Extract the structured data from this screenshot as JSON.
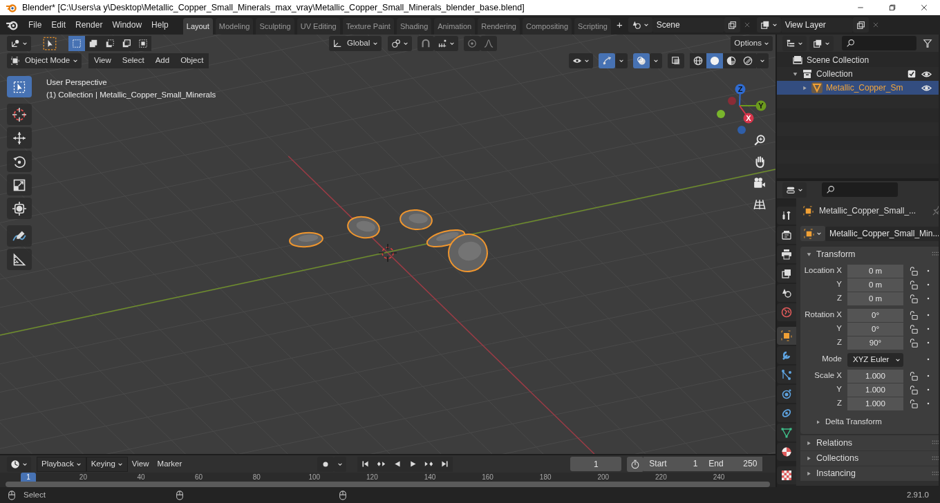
{
  "window": {
    "title": "Blender* [C:\\Users\\a y\\Desktop\\Metallic_Copper_Small_Minerals_max_vray\\Metallic_Copper_Small_Minerals_blender_base.blend]"
  },
  "menu": [
    "File",
    "Edit",
    "Render",
    "Window",
    "Help"
  ],
  "workspaces": [
    {
      "label": "Layout",
      "selected": true
    },
    {
      "label": "Modeling",
      "selected": false
    },
    {
      "label": "Sculpting",
      "selected": false
    },
    {
      "label": "UV Editing",
      "selected": false
    },
    {
      "label": "Texture Paint",
      "selected": false
    },
    {
      "label": "Shading",
      "selected": false
    },
    {
      "label": "Animation",
      "selected": false
    },
    {
      "label": "Rendering",
      "selected": false
    },
    {
      "label": "Compositing",
      "selected": false
    },
    {
      "label": "Scripting",
      "selected": false
    }
  ],
  "add_workspace": "+",
  "scene": "Scene",
  "view_layer": "View Layer",
  "tool_header": {
    "select_modes": [
      {
        "kind": "set",
        "selected": true
      },
      {
        "kind": "extend",
        "selected": false
      },
      {
        "kind": "subtract",
        "selected": false
      },
      {
        "kind": "invert",
        "selected": false
      },
      {
        "kind": "intersect",
        "selected": false
      }
    ],
    "orientation": "Global",
    "options": "Options"
  },
  "viewport_header": {
    "mode": "Object Mode",
    "menus": [
      "View",
      "Select",
      "Add",
      "Object"
    ],
    "gizmos_on": true,
    "overlays_on": true,
    "xray_on": false,
    "shading": [
      {
        "kind": "wireframe",
        "selected": false
      },
      {
        "kind": "solid",
        "selected": true
      },
      {
        "kind": "material",
        "selected": false
      },
      {
        "kind": "rendered",
        "selected": false
      }
    ]
  },
  "viewport": {
    "perspective": "User Perspective",
    "context": "(1) Collection | Metallic_Copper_Small_Minerals",
    "tools": [
      {
        "kind": "select",
        "selected": true
      },
      {
        "kind": "cursor",
        "selected": false
      },
      {
        "kind": "move",
        "selected": false
      },
      {
        "kind": "rotate",
        "selected": false
      },
      {
        "kind": "scale",
        "selected": false
      },
      {
        "kind": "transform",
        "selected": false
      },
      {
        "kind": "annotate",
        "selected": false
      },
      {
        "kind": "measure",
        "selected": false
      }
    ],
    "gizmo": {
      "z": "Z",
      "y": "Y",
      "x": "X"
    }
  },
  "outliner": {
    "items": [
      {
        "label": "Scene Collection",
        "kind": "scene",
        "selected": false,
        "children": [
          {
            "label": "Collection",
            "kind": "collection",
            "expanded": true,
            "checked": true,
            "selected": false,
            "children": [
              {
                "label": "Metallic_Copper_Sm",
                "kind": "mesh",
                "expanded": false,
                "selected": true
              }
            ]
          }
        ]
      }
    ]
  },
  "properties": {
    "tabs": [
      {
        "kind": "tool",
        "selected": false
      },
      {
        "kind": "render",
        "selected": false
      },
      {
        "kind": "output",
        "selected": false
      },
      {
        "kind": "view_layer",
        "selected": false
      },
      {
        "kind": "scene",
        "selected": false
      },
      {
        "kind": "world",
        "selected": false
      },
      {
        "kind": "object",
        "selected": true
      },
      {
        "kind": "modifiers",
        "selected": false
      },
      {
        "kind": "particles",
        "selected": false
      },
      {
        "kind": "physics",
        "selected": false
      },
      {
        "kind": "constraints",
        "selected": false
      },
      {
        "kind": "data",
        "selected": false
      },
      {
        "kind": "material",
        "selected": false
      },
      {
        "kind": "texture",
        "selected": false
      }
    ],
    "object_name": "Metallic_Copper_Small_...",
    "data_name": "Metallic_Copper_Small_Min...",
    "transform": {
      "title": "Transform",
      "expanded": true,
      "groups": [
        {
          "rows": [
            {
              "kind": "number",
              "label": "Location X",
              "value": "0 m"
            },
            {
              "kind": "number",
              "label": "Y",
              "value": "0 m"
            },
            {
              "kind": "number",
              "label": "Z",
              "value": "0 m"
            }
          ]
        },
        {
          "rows": [
            {
              "kind": "number",
              "label": "Rotation X",
              "value": "0°"
            },
            {
              "kind": "number",
              "label": "Y",
              "value": "0°"
            },
            {
              "kind": "number",
              "label": "Z",
              "value": "90°"
            }
          ]
        },
        {
          "rows": [
            {
              "kind": "dropdown",
              "label": "Mode",
              "value": "XYZ Euler"
            }
          ]
        },
        {
          "rows": [
            {
              "kind": "number",
              "label": "Scale X",
              "value": "1.000"
            },
            {
              "kind": "number",
              "label": "Y",
              "value": "1.000"
            },
            {
              "kind": "number",
              "label": "Z",
              "value": "1.000"
            }
          ]
        }
      ],
      "subpanel": {
        "title": "Delta Transform",
        "expanded": false
      }
    },
    "panels": [
      {
        "title": "Relations",
        "expanded": false
      },
      {
        "title": "Collections",
        "expanded": false
      },
      {
        "title": "Instancing",
        "expanded": false
      }
    ]
  },
  "timeline": {
    "menus": [
      "Playback",
      "Keying",
      "View",
      "Marker"
    ],
    "current_frame": "1",
    "start_label": "Start",
    "start": "1",
    "end_label": "End",
    "end": "250",
    "ruler_current": "1",
    "ruler": [
      "20",
      "40",
      "60",
      "80",
      "100",
      "120",
      "140",
      "160",
      "180",
      "200",
      "220",
      "240"
    ]
  },
  "status_bar": {
    "left_action": "Select",
    "version": "2.91.0"
  }
}
